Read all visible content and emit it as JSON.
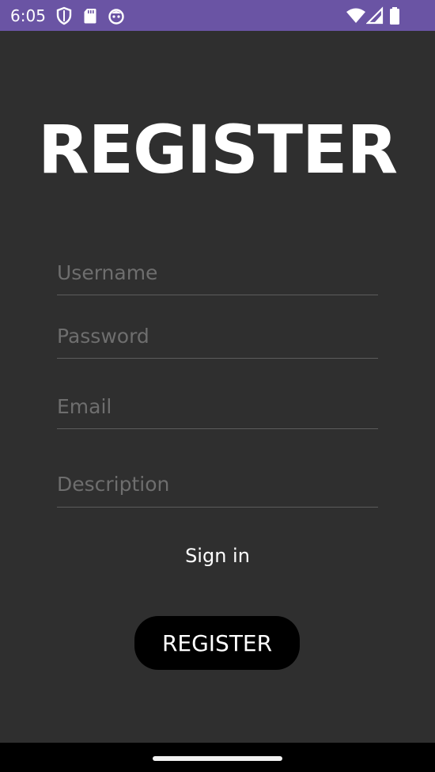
{
  "status_bar": {
    "time": "6:05",
    "left_icons": [
      "shield-icon",
      "sd-card-icon",
      "face-icon"
    ],
    "right_icons": [
      "wifi-icon",
      "signal-icon",
      "battery-icon"
    ],
    "color": "#6a54a4"
  },
  "page": {
    "title": "REGISTER"
  },
  "form": {
    "username_placeholder": "Username",
    "password_placeholder": "Password",
    "email_placeholder": "Email",
    "description_placeholder": "Description"
  },
  "actions": {
    "sign_in_label": "Sign in",
    "register_label": "REGISTER"
  },
  "colors": {
    "background": "#2f2f2f",
    "button": "#000000",
    "text": "#ffffff",
    "placeholder": "#6e6e6e",
    "underline": "#5c5c5c"
  }
}
